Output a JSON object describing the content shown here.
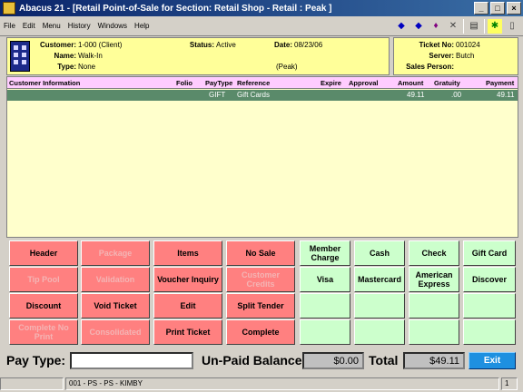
{
  "window": {
    "title": "Abacus 21 - [Retail Point-of-Sale for Section: Retail Shop - Retail : Peak ]"
  },
  "menu": [
    "File",
    "Edit",
    "Menu",
    "History",
    "Windows",
    "Help"
  ],
  "customer": {
    "customer_label": "Customer:",
    "customer_value": "1-000 (Client)",
    "name_label": "Name:",
    "name_value": "Walk-In",
    "type_label": "Type:",
    "type_value": "None",
    "status_label": "Status:",
    "status_value": "Active",
    "date_label": "Date:",
    "date_value": "08/23/06",
    "period_value": "(Peak)"
  },
  "ticket": {
    "ticket_label": "Ticket No:",
    "ticket_value": "001024",
    "server_label": "Server:",
    "server_value": "Butch",
    "sales_person_label": "Sales Person:",
    "sales_person_value": ""
  },
  "grid": {
    "headers": {
      "customer_info": "Customer Information",
      "folio": "Folio",
      "paytype": "PayType",
      "reference": "Reference",
      "expire": "Expire",
      "approval": "Approval",
      "amount": "Amount",
      "gratuity": "Gratuity",
      "payment": "Payment"
    },
    "rows": [
      {
        "paytype": "GIFT",
        "reference": "Gift Cards",
        "amount": "49.11",
        "gratuity": ".00",
        "payment": "49.11"
      }
    ]
  },
  "buttons": {
    "header": "Header",
    "package": "Package",
    "items": "Items",
    "no_sale": "No Sale",
    "tip_pool": "Tip Pool",
    "validation": "Validation",
    "voucher_inquiry": "Voucher Inquiry",
    "customer_credits": "Customer Credits",
    "discount": "Discount",
    "void_ticket": "Void Ticket",
    "edit": "Edit",
    "split_tender": "Split Tender",
    "complete_no_print": "Complete No Print",
    "consolidated": "Consolidated",
    "print_ticket": "Print Ticket",
    "complete": "Complete",
    "member_charge": "Member Charge",
    "cash": "Cash",
    "check": "Check",
    "gift_card": "Gift Card",
    "visa": "Visa",
    "mastercard": "Mastercard",
    "american_express": "American Express",
    "discover": "Discover"
  },
  "footer": {
    "pay_type_label": "Pay Type:",
    "pay_type_value": "",
    "unpaid_label": "Un-Paid Balance",
    "unpaid_value": "$0.00",
    "total_label": "Total",
    "total_value": "$49.11",
    "exit_label": "Exit"
  },
  "statusbar": {
    "session": "001 - PS - PS - KIMBY",
    "page": "1"
  },
  "colors": {
    "red_button": "#ff8080",
    "green_button": "#ccffcc",
    "info_panel": "#ffff99",
    "grid_bg": "#ffffcc",
    "grid_header": "#ffccff",
    "selected_row": "#5a8a6a",
    "exit": "#1e90e0"
  }
}
